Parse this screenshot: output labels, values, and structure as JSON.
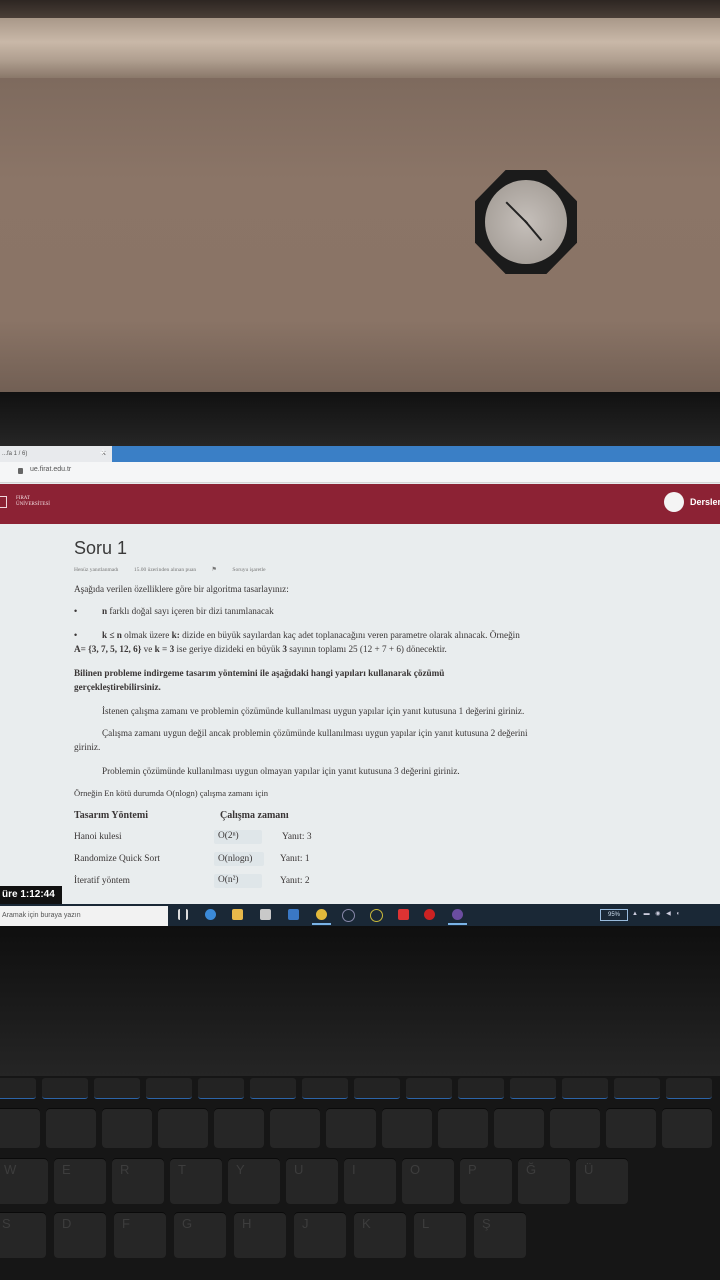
{
  "browser": {
    "tab_label": "...fa 1 / 6)",
    "tab_close": "×",
    "new_tab": "+",
    "url": "ue.firat.edu.tr"
  },
  "site": {
    "logo_line1": "FIRAT",
    "logo_line2": "ÜNİVERSİTESİ",
    "nav_label": "Dersler"
  },
  "question": {
    "title": "Soru 1",
    "status": "Henüz yanıtlanmadı",
    "points": "15.00 üzerinden alınan puan",
    "flag": "Soruyu işaretle",
    "intro": "Aşağıda verilen özelliklere göre bir algoritma tasarlayınız:",
    "bullet1_bold": "n",
    "bullet1_rest": "farklı doğal sayı içeren bir dizi tanımlanacak",
    "bullet2_bold": "k ≤ n",
    "bullet2_mid": "olmak üzere",
    "bullet2_bold2": "k:",
    "bullet2_rest": "dizide en büyük sayılardan kaç adet toplanacağını veren parametre olarak alınacak.  Örneğin",
    "example_a": "A= {3, 7, 5, 12, 6}",
    "example_ve": "ve",
    "example_k": "k = 3",
    "example_rest": "ise geriye dizideki en büyük",
    "example_num": "3",
    "example_rest2": "sayının toplamı 25 (12 + 7 + 6) dönecektir.",
    "bold_q_line1": "Bilinen probleme indirgeme tasarım yöntemini ile aşağıdaki hangi yapıları kullanarak çözümü",
    "bold_q_line2": "gerçekleştirebilirsiniz.",
    "rule1": "İstenen çalışma zamanı ve problemin çözümünde kullanılması uygun yapılar için yanıt kutusuna 1 değerini giriniz.",
    "rule2_line1": "Çalışma zamanı uygun değil ancak problemin çözümünde kullanılması uygun yapılar için yanıt kutusuna 2 değerini",
    "rule2_line2": "giriniz.",
    "rule3": "Problemin çözümünde kullanılması uygun olmayan yapılar için yanıt kutusuna 3 değerini giriniz.",
    "example_note": "Örneğin En kötü durumda O(nlogn) çalışma zamanı için"
  },
  "table": {
    "headers": [
      "Tasarım Yöntemi",
      "Çalışma zamanı"
    ],
    "rows": [
      {
        "method": "Hanoi kulesi",
        "time": "O(2ⁿ)",
        "answer": "Yanıt: 3"
      },
      {
        "method": "Randomize Quick Sort",
        "time": "O(nlogn)",
        "answer": "Yanıt: 1"
      },
      {
        "method": "İteratif yöntem",
        "time": "O(n²)",
        "answer": "Yanıt: 2"
      }
    ]
  },
  "timer": "üre 1:12:44",
  "taskbar": {
    "search_placeholder": "Aramak için buraya yazın",
    "battery": "95%"
  },
  "keyboard_letters": [
    "W",
    "E",
    "R",
    "T",
    "Y",
    "U",
    "I",
    "O",
    "P",
    "Ğ",
    "Ü",
    "S",
    "D",
    "F",
    "G",
    "H",
    "J",
    "K",
    "L",
    "Ş"
  ]
}
